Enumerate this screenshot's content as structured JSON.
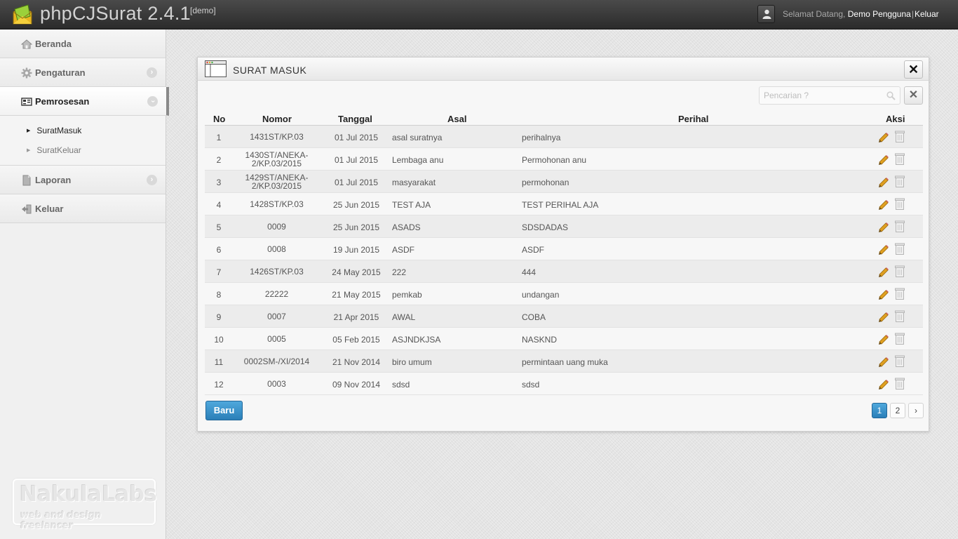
{
  "header": {
    "app_title": "phpCJSurat 2.4.1",
    "app_tag": "[demo]",
    "welcome_text": "Selamat Datang,",
    "user_name": "Demo Pengguna",
    "separator": "|",
    "logout_label": "Keluar"
  },
  "sidebar": {
    "items": [
      {
        "label": "Beranda",
        "icon": "home-icon"
      },
      {
        "label": "Pengaturan",
        "icon": "gear-icon"
      },
      {
        "label": "Pemrosesan",
        "icon": "process-icon"
      },
      {
        "label": "Laporan",
        "icon": "document-icon"
      },
      {
        "label": "Keluar",
        "icon": "logout-icon"
      }
    ],
    "subitems": [
      {
        "label": "SuratMasuk"
      },
      {
        "label": "SuratKeluar"
      }
    ],
    "brand_name": "NakulaLabs",
    "brand_tagline": "web and design freelancer"
  },
  "panel": {
    "title": "SURAT MASUK",
    "search_placeholder": "Pencarian ?",
    "columns": {
      "no": "No",
      "nomor": "Nomor",
      "tanggal": "Tanggal",
      "asal": "Asal",
      "perihal": "Perihal",
      "aksi": "Aksi"
    },
    "rows": [
      {
        "no": "1",
        "nomor": "1431ST/KP.03",
        "tanggal": "01 Jul 2015",
        "asal": "asal suratnya",
        "perihal": "perihalnya"
      },
      {
        "no": "2",
        "nomor": "1430ST/ANEKA-2/KP.03/2015",
        "nomor_l1": "1430ST/ANEKA-",
        "nomor_l2": "2/KP.03/2015",
        "tanggal": "01 Jul 2015",
        "asal": "Lembaga anu",
        "perihal": "Permohonan anu"
      },
      {
        "no": "3",
        "nomor": "1429ST/ANEKA-2/KP.03/2015",
        "nomor_l1": "1429ST/ANEKA-",
        "nomor_l2": "2/KP.03/2015",
        "tanggal": "01 Jul 2015",
        "asal": "masyarakat",
        "perihal": "permohonan"
      },
      {
        "no": "4",
        "nomor": "1428ST/KP.03",
        "tanggal": "25 Jun 2015",
        "asal": "TEST AJA",
        "perihal": "TEST PERIHAL AJA"
      },
      {
        "no": "5",
        "nomor": "0009",
        "tanggal": "25 Jun 2015",
        "asal": "ASADS",
        "perihal": "SDSDADAS"
      },
      {
        "no": "6",
        "nomor": "0008",
        "tanggal": "19 Jun 2015",
        "asal": "ASDF",
        "perihal": "ASDF"
      },
      {
        "no": "7",
        "nomor": "1426ST/KP.03",
        "tanggal": "24 May 2015",
        "asal": "222",
        "perihal": "444"
      },
      {
        "no": "8",
        "nomor": "22222",
        "tanggal": "21 May 2015",
        "asal": "pemkab",
        "perihal": "undangan"
      },
      {
        "no": "9",
        "nomor": "0007",
        "tanggal": "21 Apr 2015",
        "asal": "AWAL",
        "perihal": "COBA"
      },
      {
        "no": "10",
        "nomor": "0005",
        "tanggal": "05 Feb 2015",
        "asal": "ASJNDKJSA",
        "perihal": "NASKND"
      },
      {
        "no": "11",
        "nomor": "0002SM-/XI/2014",
        "tanggal": "21 Nov 2014",
        "asal": "biro umum",
        "perihal": "permintaan uang muka"
      },
      {
        "no": "12",
        "nomor": "0003",
        "tanggal": "09 Nov 2014",
        "asal": "sdsd",
        "perihal": "sdsd"
      }
    ],
    "new_button": "Baru",
    "pagination": {
      "pages": [
        "1",
        "2"
      ],
      "current": "1",
      "next": "›"
    }
  },
  "colors": {
    "accent_blue": "#2b7fb8",
    "topbar": "#333333",
    "edit_icon": "#e0a020"
  }
}
